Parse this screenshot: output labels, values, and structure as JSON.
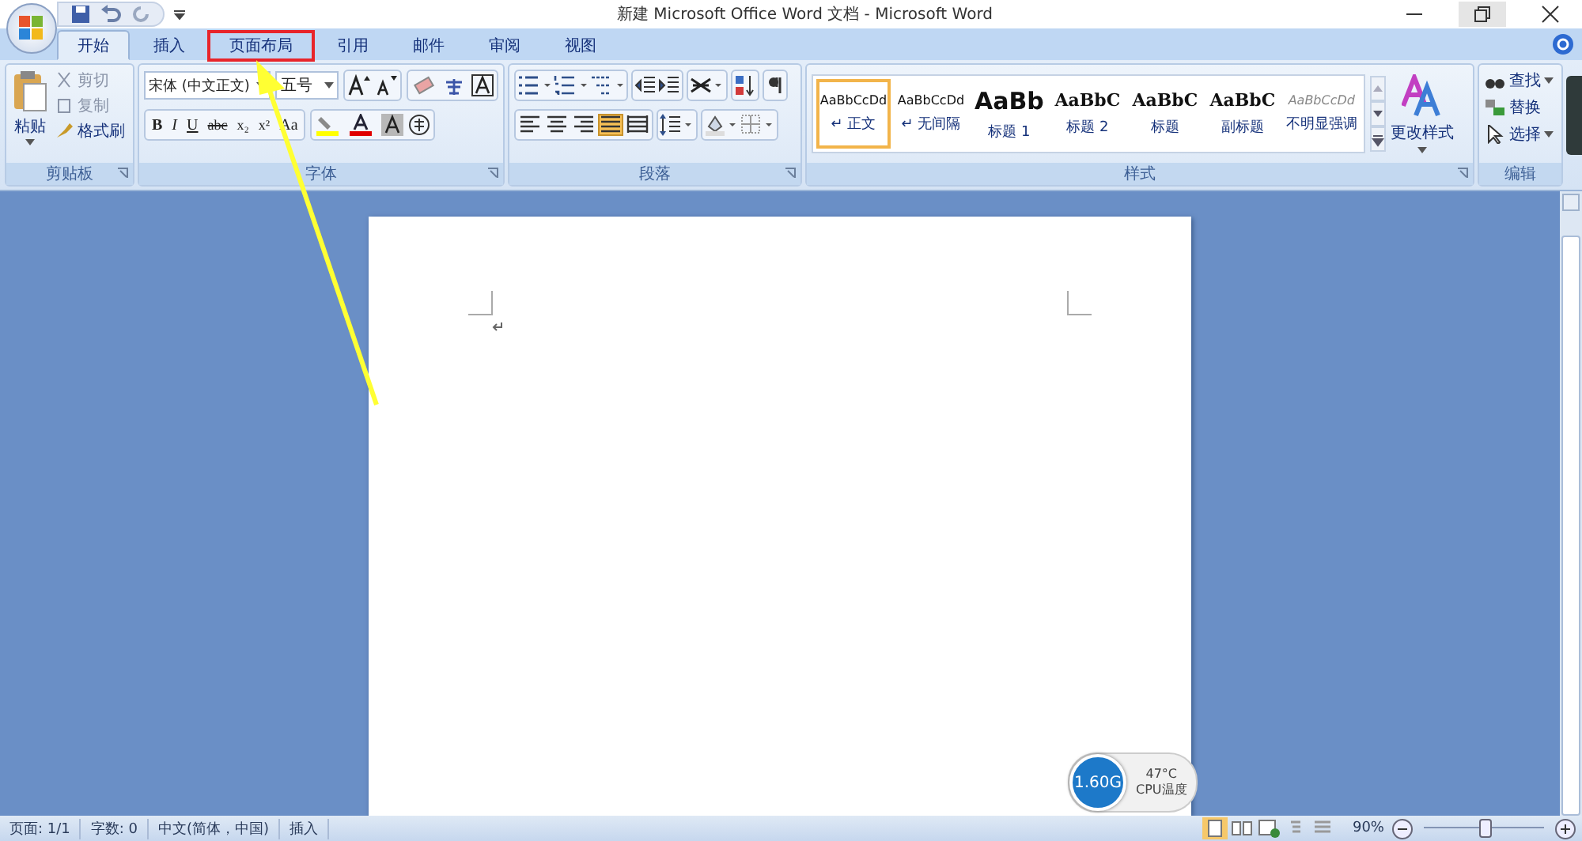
{
  "window": {
    "title": "新建 Microsoft Office Word 文档 - Microsoft Word"
  },
  "tabs": [
    {
      "label": "开始",
      "selected": true,
      "annotated": false
    },
    {
      "label": "插入",
      "selected": false,
      "annotated": false
    },
    {
      "label": "页面布局",
      "selected": false,
      "annotated": true
    },
    {
      "label": "引用",
      "selected": false,
      "annotated": false
    },
    {
      "label": "邮件",
      "selected": false,
      "annotated": false
    },
    {
      "label": "审阅",
      "selected": false,
      "annotated": false
    },
    {
      "label": "视图",
      "selected": false,
      "annotated": false
    }
  ],
  "clipboard": {
    "label": "剪贴板",
    "paste": "粘贴",
    "items": [
      {
        "label": "剪切",
        "disabled": true
      },
      {
        "label": "复制",
        "disabled": true
      },
      {
        "label": "格式刷",
        "disabled": false
      }
    ]
  },
  "font": {
    "label": "字体",
    "font_name": "宋体 (中文正文)",
    "font_size": "五号",
    "format_buttons": [
      "B",
      "I",
      "U",
      "abc",
      "x₂",
      "x²",
      "Aa"
    ]
  },
  "paragraph": {
    "label": "段落",
    "alignments": [
      {
        "selected": false
      },
      {
        "selected": false
      },
      {
        "selected": false
      },
      {
        "selected": true
      },
      {
        "selected": false
      }
    ]
  },
  "styles": {
    "label": "样式",
    "change_styles": "更改样式",
    "items": [
      {
        "preview": "AaBbCcDd",
        "name": "↵ 正文",
        "kind": "normal",
        "selected": true
      },
      {
        "preview": "AaBbCcDd",
        "name": "↵ 无间隔",
        "kind": "normal",
        "selected": false
      },
      {
        "preview": "AaBb",
        "name": "标题 1",
        "kind": "heading1",
        "selected": false
      },
      {
        "preview": "AaBbC",
        "name": "标题 2",
        "kind": "heading",
        "selected": false
      },
      {
        "preview": "AaBbC",
        "name": "标题",
        "kind": "heading",
        "selected": false
      },
      {
        "preview": "AaBbC",
        "name": "副标题",
        "kind": "heading",
        "selected": false
      },
      {
        "preview": "AaBbCcDd",
        "name": "不明显强调",
        "kind": "subtle",
        "selected": false
      }
    ]
  },
  "editing": {
    "label": "编辑",
    "items": [
      "查找",
      "替换",
      "选择"
    ]
  },
  "cpu_widget": {
    "speed": "1.60G",
    "temperature": "47°C",
    "label": "CPU温度"
  },
  "status_bar": {
    "items": [
      "页面: 1/1",
      "字数: 0",
      "中文(简体，中国)",
      "插入"
    ],
    "zoom": "90%",
    "level": 0.5
  }
}
